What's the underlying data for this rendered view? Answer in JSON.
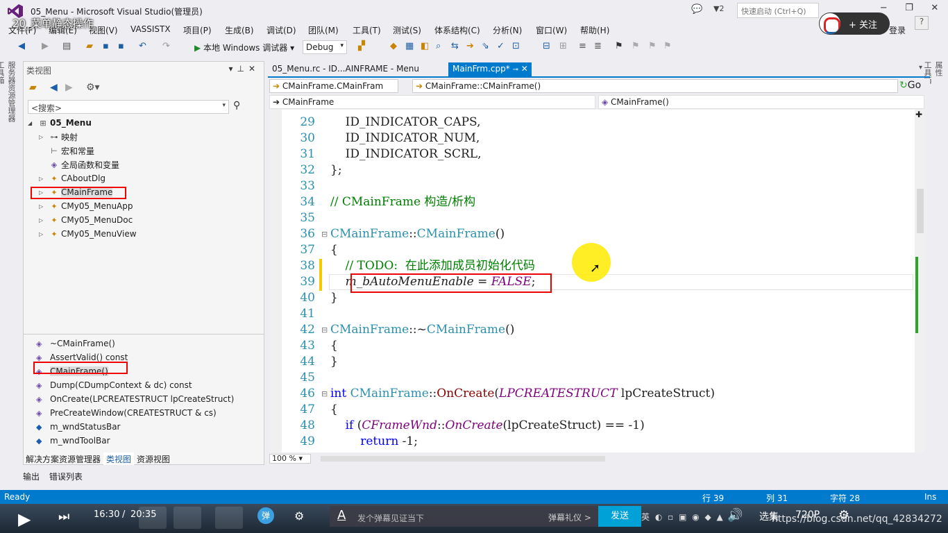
{
  "window": {
    "title": "05_Menu - Microsoft Visual Studio(管理员)",
    "video_title": "20_菜单静态操作",
    "notif_count": "2",
    "quick_launch_placeholder": "快速启动 (Ctrl+Q)",
    "follow_label": "+ 关注",
    "login_label": "登录",
    "help_label": "?"
  },
  "menu": [
    "文件(F)",
    "编辑(E)",
    "视图(V)",
    "VASSISTX",
    "项目(P)",
    "生成(B)",
    "调试(D)",
    "团队(M)",
    "工具(T)",
    "测试(S)",
    "体系结构(C)",
    "分析(N)",
    "窗口(W)",
    "帮助(H)"
  ],
  "toolbar": {
    "debugger_label": "本地 Windows 调试器",
    "config": "Debug"
  },
  "left_vtabs": "服务器资源管理器  工具箱",
  "right_vtabs": [
    "属性",
    "工具箱"
  ],
  "classview": {
    "title": "类视图",
    "search_placeholder": "<搜索>",
    "tree": [
      {
        "label": "05_Menu",
        "bold": true
      },
      {
        "label": "映射"
      },
      {
        "label": "宏和常量"
      },
      {
        "label": "全局函数和变量"
      },
      {
        "label": "CAboutDlg"
      },
      {
        "label": "CMainFrame"
      },
      {
        "label": "CMy05_MenuApp"
      },
      {
        "label": "CMy05_MenuDoc"
      },
      {
        "label": "CMy05_MenuView"
      }
    ],
    "members": [
      "~CMainFrame()",
      "AssertValid() const",
      "CMainFrame()",
      "Dump(CDumpContext & dc) const",
      "OnCreate(LPCREATESTRUCT lpCreateStruct)",
      "PreCreateWindow(CREATESTRUCT & cs)",
      "m_wndStatusBar",
      "m_wndToolBar"
    ],
    "bottom_tabs": [
      "解决方案资源管理器",
      "类视图",
      "资源视图"
    ]
  },
  "output_tabs": [
    "输出",
    "错误列表"
  ],
  "editor": {
    "tabs": [
      "05_Menu.rc - ID...AINFRAME - Menu",
      "MainFrm.cpp*"
    ],
    "nav1_left": "CMainFrame.CMainFram",
    "nav1_right": "CMainFrame::CMainFrame()",
    "nav2_left": "CMainFrame",
    "nav2_right": "CMainFrame()",
    "go": "Go",
    "zoom": "100 %",
    "lines": [
      {
        "n": "29",
        "t": "    ID_INDICATOR_CAPS,"
      },
      {
        "n": "30",
        "t": "    ID_INDICATOR_NUM,"
      },
      {
        "n": "31",
        "t": "    ID_INDICATOR_SCRL,"
      },
      {
        "n": "32",
        "t": "};"
      },
      {
        "n": "33",
        "t": ""
      },
      {
        "n": "34",
        "t": "// CMainFrame 构造/析构"
      },
      {
        "n": "35",
        "t": ""
      },
      {
        "n": "36",
        "t": "CMainFrame::CMainFrame()"
      },
      {
        "n": "37",
        "t": "{"
      },
      {
        "n": "38",
        "t": "    // TODO:  在此添加成员初始化代码"
      },
      {
        "n": "39",
        "t": "    m_bAutoMenuEnable = FALSE;"
      },
      {
        "n": "40",
        "t": "}"
      },
      {
        "n": "41",
        "t": ""
      },
      {
        "n": "42",
        "t": "CMainFrame::~CMainFrame()"
      },
      {
        "n": "43",
        "t": "{"
      },
      {
        "n": "44",
        "t": "}"
      },
      {
        "n": "45",
        "t": ""
      },
      {
        "n": "46",
        "t": "int CMainFrame::OnCreate(LPCREATESTRUCT lpCreateStruct)"
      },
      {
        "n": "47",
        "t": "{"
      },
      {
        "n": "48",
        "t": "    if (CFrameWnd::OnCreate(lpCreateStruct) == -1)"
      },
      {
        "n": "49",
        "t": "        return -1;"
      }
    ]
  },
  "status": {
    "ready": "Ready",
    "line": "行 39",
    "col": "列 31",
    "char": "字符 28",
    "ins": "Ins"
  },
  "player": {
    "time_current": "16:30",
    "time_sep": "/",
    "time_total": "20:35",
    "danmaku_btn": "弹",
    "danmaku_placeholder": "发个弹幕见证当下",
    "danmaku_etiquette": "弹幕礼仪 >",
    "send": "发送",
    "quality": "选集",
    "resolution": "720P",
    "watermark": "https://blog.csdn.net/qq_42834272",
    "ime": "英"
  }
}
